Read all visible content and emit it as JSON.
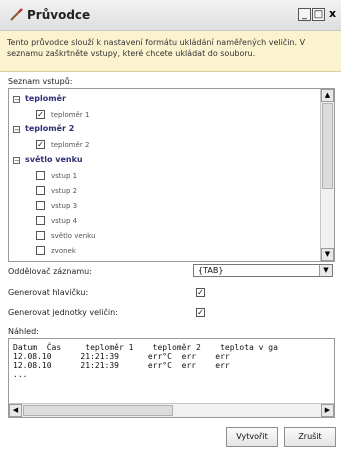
{
  "window": {
    "title": "Průvodce",
    "controls": {
      "minimize": "_",
      "maximize": "□",
      "close": "x"
    }
  },
  "banner": {
    "text": "Tento průvodce slouží k nastavení formátu ukládání naměřených veličin. V seznamu zaškrtněte vstupy, které chcete ukládat do souboru."
  },
  "inputs_list": {
    "label": "Seznam vstupů:",
    "groups": [
      {
        "label": "teploměr",
        "children": [
          {
            "label": "teploměr 1",
            "checked": true
          }
        ]
      },
      {
        "label": "teploměr 2",
        "children": [
          {
            "label": "teploměr 2",
            "checked": true
          }
        ]
      },
      {
        "label": "světlo venku",
        "children": [
          {
            "label": "vstup 1",
            "checked": false
          },
          {
            "label": "vstup 2",
            "checked": false
          },
          {
            "label": "vstup 3",
            "checked": false
          },
          {
            "label": "vstup 4",
            "checked": false
          },
          {
            "label": "světlo venku",
            "checked": false
          },
          {
            "label": "zvonek",
            "checked": false
          }
        ]
      }
    ]
  },
  "separator": {
    "label": "Oddělovač záznamu:",
    "value": "{TAB}"
  },
  "generate_header": {
    "label": "Generovat hlavičku:",
    "checked": true
  },
  "generate_units": {
    "label": "Generovat jednotky veličin:",
    "checked": true
  },
  "preview": {
    "label": "Náhled:",
    "lines": [
      "Datum  Čas     teploměr 1    teploměr 2    teplota v ga",
      "12.08.10      21:21:39      err°C  err    err",
      "12.08.10      21:21:39      err°C  err    err",
      "..."
    ]
  },
  "buttons": {
    "create": "Vytvořit",
    "cancel": "Zrušit"
  },
  "icons": {
    "wizard": "wand-icon",
    "check": "✓"
  },
  "colors": {
    "banner_bg": "#fbf2cf",
    "group_text": "#2f2f74"
  }
}
